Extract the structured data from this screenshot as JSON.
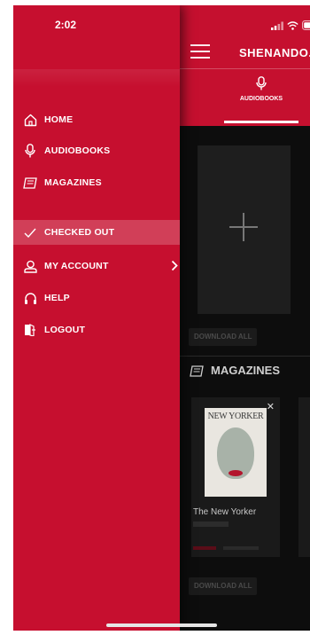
{
  "status_bar": {
    "time": "2:02"
  },
  "app": {
    "title": "SHENANDO...",
    "tab_label": "AUDIOBOOKS",
    "download_all_1": "DOWNLOAD ALL",
    "download_all_2": "DOWNLOAD ALL",
    "magazines_section": "MAGAZINES",
    "magazine_cover_title": "NEW YORKER",
    "magazine_name": "The New Yorker"
  },
  "drawer": {
    "items": [
      {
        "label": "HOME",
        "icon": "home-icon"
      },
      {
        "label": "AUDIOBOOKS",
        "icon": "microphone-icon"
      },
      {
        "label": "MAGAZINES",
        "icon": "magazine-icon"
      },
      {
        "label": "CHECKED OUT",
        "icon": "checkmark-icon",
        "selected": true
      },
      {
        "label": "MY ACCOUNT",
        "icon": "user-icon"
      },
      {
        "label": "HELP",
        "icon": "headphones-icon"
      },
      {
        "label": "LOGOUT",
        "icon": "logout-icon"
      }
    ]
  },
  "colors": {
    "brand_red": "#c60f2f",
    "background": "#0d0d0d"
  }
}
